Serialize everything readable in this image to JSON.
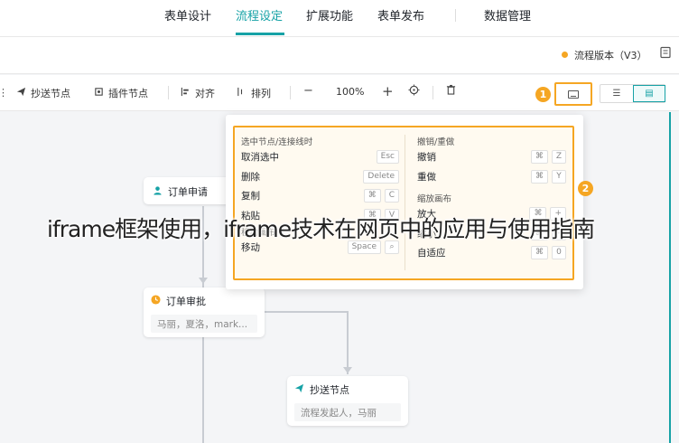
{
  "nav": {
    "items": [
      "表单设计",
      "流程设定",
      "扩展功能",
      "表单发布",
      "数据管理"
    ],
    "active_index": 1
  },
  "header": {
    "version_label": "流程版本（V3）",
    "right_icon": "book-icon"
  },
  "toolbar": {
    "cc_node": "抄送节点",
    "plugin_node": "插件节点",
    "align": "对齐",
    "arrange": "排列",
    "zoom": "100%",
    "keyboard_icon": "keyboard-icon",
    "view_list_icon": "list-view-icon",
    "view_card_icon": "card-view-icon"
  },
  "badges": {
    "one": "1",
    "two": "2"
  },
  "flow": {
    "node1": {
      "title": "订单申请",
      "icon": "user-icon"
    },
    "node2": {
      "title": "订单审批",
      "body": "马丽，夏洛，mark...",
      "icon": "clock-icon"
    },
    "node3": {
      "title": "抄送节点",
      "body": "流程发起人，马丽",
      "icon": "send-icon"
    }
  },
  "shortcuts": {
    "left_title": "选中节点/连接线时",
    "left_rows": [
      {
        "label": "取消选中",
        "keys": [
          "Esc"
        ]
      },
      {
        "label": "删除",
        "keys": [
          "Delete"
        ]
      },
      {
        "label": "复制",
        "keys": [
          "⌘",
          "C"
        ]
      },
      {
        "label": "粘贴",
        "keys": [
          "⌘",
          "V"
        ]
      }
    ],
    "left_title2": "移动画布",
    "left_rows2": [
      {
        "label": "移动",
        "keys": [
          "Space",
          "⌕"
        ]
      }
    ],
    "right_title": "撤销/重做",
    "right_rows": [
      {
        "label": "撤销",
        "keys": [
          "⌘",
          "Z"
        ]
      },
      {
        "label": "重做",
        "keys": [
          "⌘",
          "Y"
        ]
      }
    ],
    "right_title2": "缩放画布",
    "right_rows2": [
      {
        "label": "放大",
        "keys": [
          "⌘",
          "+"
        ]
      },
      {
        "label": "缩小",
        "keys": [
          "⌘",
          "-"
        ]
      },
      {
        "label": "自适应",
        "keys": [
          "⌘",
          "0"
        ]
      }
    ]
  },
  "caption": "iframe框架使用，iframe技术在网页中的应用与使用指南",
  "colors": {
    "accent": "#16a2a6",
    "highlight": "#f5a623"
  }
}
